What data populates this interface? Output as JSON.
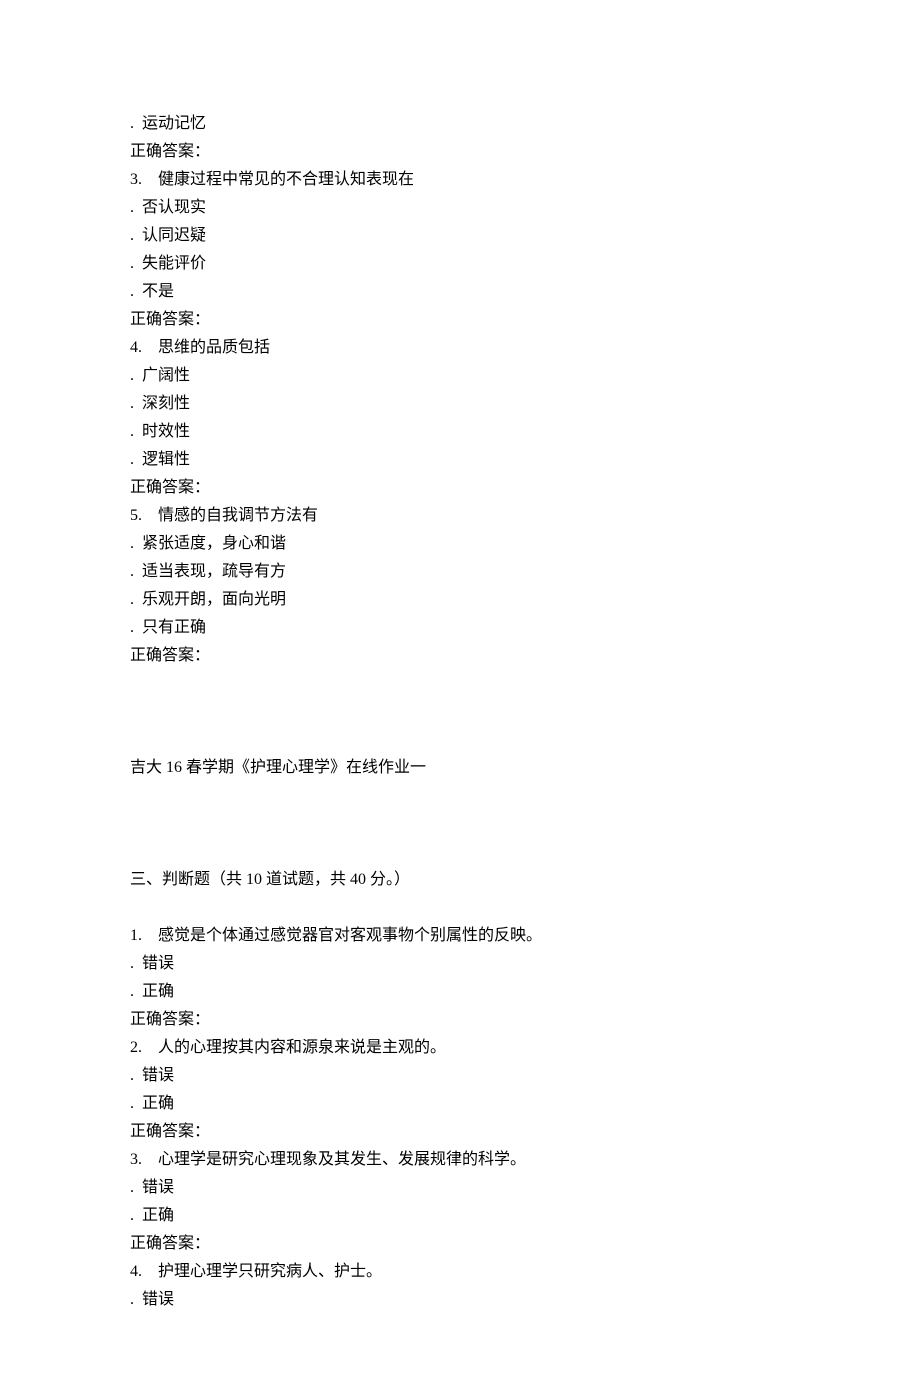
{
  "labels": {
    "correct_answer": "正确答案："
  },
  "partial_q2": {
    "option_d": ".  运动记忆"
  },
  "q3": {
    "number": "3.",
    "stem": "健康过程中常见的不合理认知表现在",
    "options": [
      ".  否认现实",
      ".  认同迟疑",
      ".  失能评价",
      ".  不是"
    ]
  },
  "q4": {
    "number": "4.",
    "stem": "思维的品质包括",
    "options": [
      ".  广阔性",
      ".  深刻性",
      ".  时效性",
      ".  逻辑性"
    ]
  },
  "q5": {
    "number": "5.",
    "stem": "情感的自我调节方法有",
    "options": [
      ".  紧张适度，身心和谐",
      ".  适当表现，疏导有方",
      ".  乐观开朗，面向光明",
      ".  只有正确"
    ]
  },
  "divider_title": "吉大 16 春学期《护理心理学》在线作业一",
  "section3": {
    "header": "三、判断题（共 10 道试题，共 40 分。）",
    "q1": {
      "number": "1.",
      "stem": "感觉是个体通过感觉器官对客观事物个别属性的反映。",
      "options": [
        ".  错误",
        ".  正确"
      ]
    },
    "q2": {
      "number": "2.",
      "stem": "人的心理按其内容和源泉来说是主观的。",
      "options": [
        ".  错误",
        ".  正确"
      ]
    },
    "q3": {
      "number": "3.",
      "stem": "心理学是研究心理现象及其发生、发展规律的科学。",
      "options": [
        ".  错误",
        ".  正确"
      ]
    },
    "q4": {
      "number": "4.",
      "stem": "护理心理学只研究病人、护士。",
      "options": [
        ".  错误"
      ]
    }
  }
}
